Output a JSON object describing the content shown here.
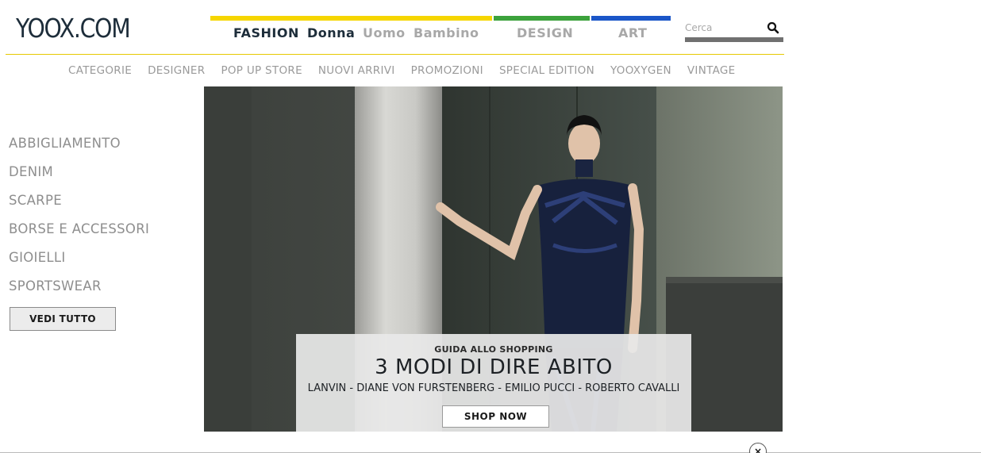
{
  "header": {
    "logo": "YOOX.COM",
    "nav_fashion": "FASHION",
    "nav_donna": "Donna",
    "nav_uomo": "Uomo",
    "nav_bambino": "Bambino",
    "nav_design": "DESIGN",
    "nav_art": "ART",
    "search_placeholder": "Cerca",
    "colors": {
      "fashion": "#f6d600",
      "design": "#3ca23c",
      "art": "#1b56c8"
    }
  },
  "subnav": {
    "items": [
      "CATEGORIE",
      "DESIGNER",
      "POP UP STORE",
      "NUOVI ARRIVI",
      "PROMOZIONI",
      "SPECIAL EDITION",
      "YOOXYGEN",
      "VINTAGE"
    ]
  },
  "sidebar": {
    "items": [
      "ABBIGLIAMENTO",
      "DENIM",
      "SCARPE",
      "BORSE E ACCESSORI",
      "GIOIELLI",
      "SPORTSWEAR"
    ],
    "button_label": "VEDI TUTTO"
  },
  "promo": {
    "kicker": "GUIDA ALLO SHOPPING",
    "title": "3 MODI DI DIRE ABITO",
    "brands": "LANVIN - DIANE VON FURSTENBERG - EMILIO PUCCI - ROBERTO CAVALLI",
    "button_label": "SHOP NOW"
  },
  "footer": {
    "close_icon": "×"
  }
}
